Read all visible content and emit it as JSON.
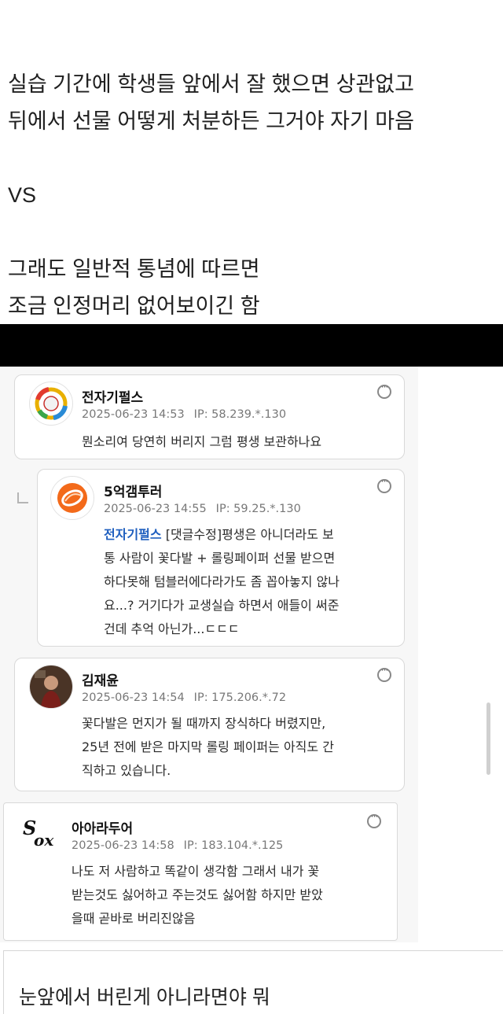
{
  "post": {
    "lines": [
      "실습 기간에 학생들 앞에서 잘 했으면 상관없고",
      "뒤에서 선물 어떻게 처분하든 그거야 자기 마음",
      "VS",
      "그래도 일반적 통념에 따르면",
      "조금 인정머리 없어보이긴 함"
    ]
  },
  "comments": [
    {
      "username": "전자기펄스",
      "date": "2025-06-23 14:53",
      "ip": "IP: 58.239.*.130",
      "text": "뭔소리여 당연히 버리지 그럼 평생 보관하나요",
      "avatar_icon": "baseball-globe-logo-icon"
    },
    {
      "username": "5억갬투러",
      "date": "2025-06-23 14:55",
      "ip": "IP: 59.25.*.130",
      "mention": "전자기펄스",
      "lines": [
        "[댓글수정]평생은 아니더라도 보",
        "통 사람이 꽃다발 + 롤링페이퍼 선물 받으면",
        "하다못해 텀블러에다라가도 좀 꼽아놓지 않나",
        "요...? 거기다가 교생실습 하면서 애들이 써준",
        "건데 추억 아닌가...ㄷㄷㄷ"
      ],
      "avatar_icon": "orange-swirl-logo-icon"
    },
    {
      "username": "김재윤",
      "date": "2025-06-23 14:54",
      "ip": "IP: 175.206.*.72",
      "lines": [
        "꽃다발은 먼지가 될 때까지 장식하다 버렸지만,",
        "25년 전에 받은 마지막 롤링 페이퍼는 아직도 간",
        "직하고 있습니다."
      ],
      "avatar_icon": "person-photo-avatar"
    },
    {
      "username": "아아라두어",
      "date": "2025-06-23 14:58",
      "ip": "IP: 183.104.*.125",
      "lines": [
        "나도 저 사람하고 똑같이 생각함 그래서 내가 꽃",
        "받는것도 싫어하고 주는것도 싫어함 하지만 받았",
        "을때 곧바로 버리진않음"
      ],
      "avatar_icon": "white-sox-logo-icon"
    }
  ],
  "bottom": {
    "text": "눈앞에서 버린게 아니라면야 뭐"
  }
}
